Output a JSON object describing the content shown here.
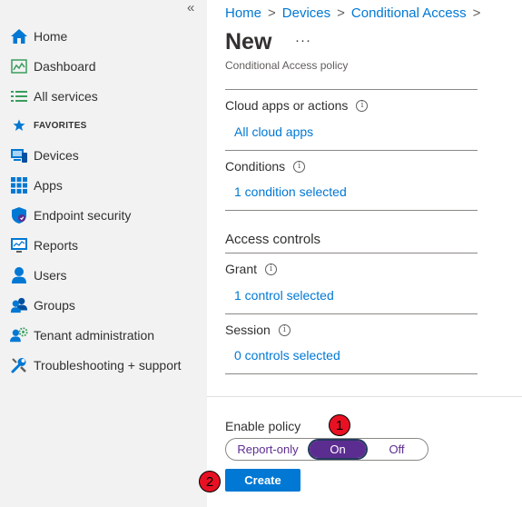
{
  "sidebar": {
    "collapse_glyph": "«",
    "items": [
      {
        "label": "Home",
        "icon": "home-icon"
      },
      {
        "label": "Dashboard",
        "icon": "dashboard-icon"
      },
      {
        "label": "All services",
        "icon": "list-icon"
      },
      {
        "label": "FAVORITES",
        "icon": "star-icon"
      },
      {
        "label": "Devices",
        "icon": "devices-icon"
      },
      {
        "label": "Apps",
        "icon": "apps-grid-icon"
      },
      {
        "label": "Endpoint security",
        "icon": "shield-icon"
      },
      {
        "label": "Reports",
        "icon": "reports-icon"
      },
      {
        "label": "Users",
        "icon": "user-icon"
      },
      {
        "label": "Groups",
        "icon": "groups-icon"
      },
      {
        "label": "Tenant administration",
        "icon": "tenant-admin-icon"
      },
      {
        "label": "Troubleshooting + support",
        "icon": "wrench-icon"
      }
    ]
  },
  "breadcrumb": {
    "items": [
      "Home",
      "Devices",
      "Conditional Access"
    ],
    "separator": ">"
  },
  "page": {
    "title": "New",
    "more": "···",
    "subtitle": "Conditional Access policy"
  },
  "sections": {
    "cloud_apps": {
      "label": "Cloud apps or actions",
      "value": "All cloud apps"
    },
    "conditions": {
      "label": "Conditions",
      "value": "1 condition selected"
    },
    "access_controls": {
      "heading": "Access controls"
    },
    "grant": {
      "label": "Grant",
      "value": "1 control selected"
    },
    "session": {
      "label": "Session",
      "value": "0 controls selected"
    }
  },
  "enable_policy": {
    "label": "Enable policy",
    "options": [
      "Report-only",
      "On",
      "Off"
    ],
    "selected": "On"
  },
  "create_button": "Create",
  "badges": [
    "1",
    "2"
  ],
  "colors": {
    "accent": "#0078d4",
    "toggle_selected": "#5c2d91",
    "badge": "#e81123"
  }
}
